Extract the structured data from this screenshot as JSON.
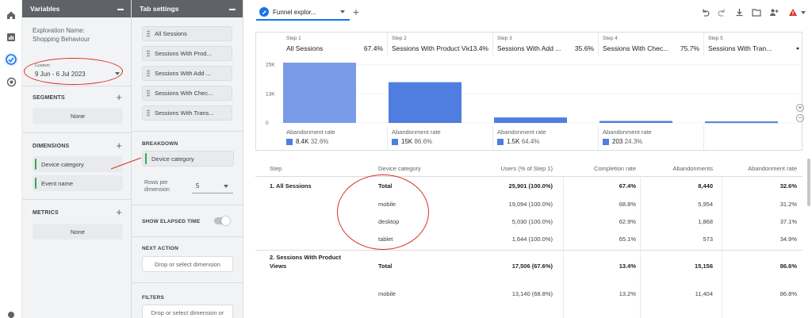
{
  "variables": {
    "title": "Variables",
    "exploration_label": "Exploration Name:",
    "exploration_name": "Shopping Behaviour",
    "date_label": "Custom",
    "date_range": "9 Jun - 6 Jul 2023",
    "segments_title": "SEGMENTS",
    "segments_none": "None",
    "dimensions_title": "DIMENSIONS",
    "dimensions": [
      "Device category",
      "Event name"
    ],
    "metrics_title": "METRICS",
    "metrics_none": "None"
  },
  "tab_settings": {
    "title": "Tab settings",
    "steps": [
      "All Sessions",
      "Sessions With Prod...",
      "Sessions With Add ...",
      "Sessions With Chec...",
      "Sessions With Trans..."
    ],
    "breakdown_title": "BREAKDOWN",
    "breakdown_value": "Device category",
    "rows_per_label": "Rows per dimension",
    "rows_per_value": "5",
    "show_elapsed_label": "SHOW ELAPSED TIME",
    "next_action_title": "NEXT ACTION",
    "next_action_placeholder": "Drop or select dimension",
    "filters_title": "FILTERS",
    "filters_placeholder": "Drop or select dimension or"
  },
  "tab": {
    "label": "Funnel explor..."
  },
  "chart_data": {
    "type": "bar",
    "categories": [
      "All Sessions",
      "Sessions With Product Views",
      "Sessions With Add ...",
      "Sessions With Chec...",
      "Sessions With Tran..."
    ],
    "step_numbers": [
      "Step 1",
      "Step 2",
      "Step 3",
      "Step 4",
      "Step 5"
    ],
    "step_pcts": [
      "67.4%",
      "13.4%",
      "35.6%",
      "75.7%",
      ""
    ],
    "values": [
      25901,
      17506,
      2350,
      837,
      634
    ],
    "ylim": [
      0,
      30000
    ],
    "y_ticks": [
      {
        "v": 25000,
        "label": "25K"
      },
      {
        "v": 12500,
        "label": "13K"
      },
      {
        "v": 0,
        "label": "0"
      }
    ],
    "abandonment_label": "Abandonment rate",
    "abandonment": [
      {
        "count": "8.4K",
        "pct": "32.6%"
      },
      {
        "count": "15K",
        "pct": "86.6%"
      },
      {
        "count": "1.5K",
        "pct": "64.4%"
      },
      {
        "count": "203",
        "pct": "24.3%"
      }
    ]
  },
  "table": {
    "headers": [
      "Step",
      "Device category",
      "Users (% of Step 1)",
      "Completion rate",
      "Abandonments",
      "Abandonment rate"
    ],
    "rows": [
      {
        "step": "1. All Sessions",
        "device": "Total",
        "users": "25,901 (100.0%)",
        "completion": "67.4%",
        "abandon": "8,440",
        "rate": "32.6%",
        "bold": true
      },
      {
        "step": "",
        "device": "mobile",
        "users": "19,094 (100.0%)",
        "completion": "68.8%",
        "abandon": "5,954",
        "rate": "31.2%"
      },
      {
        "step": "",
        "device": "desktop",
        "users": "5,030 (100.0%)",
        "completion": "62.9%",
        "abandon": "1,868",
        "rate": "37.1%"
      },
      {
        "step": "",
        "device": "tablet",
        "users": "1,644 (100.0%)",
        "completion": "65.1%",
        "abandon": "573",
        "rate": "34.9%"
      },
      {
        "step": "2. Sessions With Product",
        "step2": "Views",
        "device": "Total",
        "users": "17,506 (67.6%)",
        "completion": "13.4%",
        "abandon": "15,156",
        "rate": "86.6%",
        "bold": true
      },
      {
        "step": "",
        "device": "mobile",
        "users": "13,140 (68.8%)",
        "completion": "13.2%",
        "abandon": "11,404",
        "rate": "86.8%"
      }
    ]
  },
  "colors": {
    "accent": "#1a73e8",
    "bar": "#4f7ee0",
    "annotation": "#d93025"
  }
}
